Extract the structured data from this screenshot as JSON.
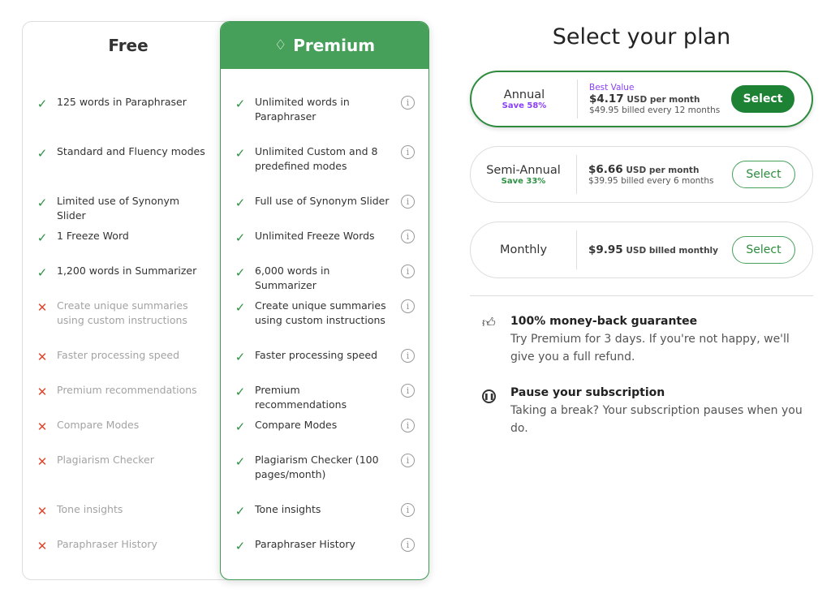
{
  "free": {
    "title": "Free",
    "features": [
      {
        "text": "125 words in Paraphraser",
        "included": true
      },
      {
        "text": "Standard and Fluency modes",
        "included": true
      },
      {
        "text": "Limited use of Synonym Slider",
        "included": true
      },
      {
        "text": "1 Freeze Word",
        "included": true
      },
      {
        "text": "1,200 words in Summarizer",
        "included": true
      },
      {
        "text": "Create unique summaries using custom instructions",
        "included": false
      },
      {
        "text": "Faster processing speed",
        "included": false
      },
      {
        "text": "Premium recommendations",
        "included": false
      },
      {
        "text": "Compare Modes",
        "included": false
      },
      {
        "text": "Plagiarism Checker",
        "included": false
      },
      {
        "text": "Tone insights",
        "included": false
      },
      {
        "text": "Paraphraser History",
        "included": false
      }
    ]
  },
  "premium": {
    "title": "Premium",
    "icon": "diamond-icon",
    "features": [
      {
        "text": "Unlimited words in Paraphraser"
      },
      {
        "text": "Unlimited Custom and 8 predefined modes"
      },
      {
        "text": "Full use of Synonym Slider"
      },
      {
        "text": "Unlimited Freeze Words"
      },
      {
        "text": "6,000 words in Summarizer"
      },
      {
        "text": "Create unique summaries using custom instructions"
      },
      {
        "text": "Faster processing speed"
      },
      {
        "text": "Premium recommendations"
      },
      {
        "text": "Compare Modes"
      },
      {
        "text": "Plagiarism Checker (100 pages/month)"
      },
      {
        "text": "Tone insights"
      },
      {
        "text": "Paraphraser History"
      }
    ]
  },
  "plans": {
    "title": "Select your plan",
    "items": [
      {
        "name": "Annual",
        "save": "Save 58%",
        "badge": "Best Value",
        "price": "$4.17",
        "unit": "USD per month",
        "billed": "$49.95 billed every 12 months",
        "button": "Select",
        "selected": true
      },
      {
        "name": "Semi-Annual",
        "save": "Save 33%",
        "price": "$6.66",
        "unit": "USD per month",
        "billed": "$39.95 billed every 6 months",
        "button": "Select"
      },
      {
        "name": "Monthly",
        "price": "$9.95",
        "unit": "USD billed monthly",
        "button": "Select"
      }
    ]
  },
  "guarantee": {
    "title": "100% money-back guarantee",
    "text": "Try Premium for 3 days. If you're not happy, we'll give you a full refund."
  },
  "pause": {
    "title": "Pause your subscription",
    "text": "Taking a break? Your subscription pauses when you do."
  },
  "colors": {
    "accent": "#46a05a",
    "button": "#1e8235",
    "best_value": "#8a3ffc",
    "cross": "#e0472f"
  }
}
